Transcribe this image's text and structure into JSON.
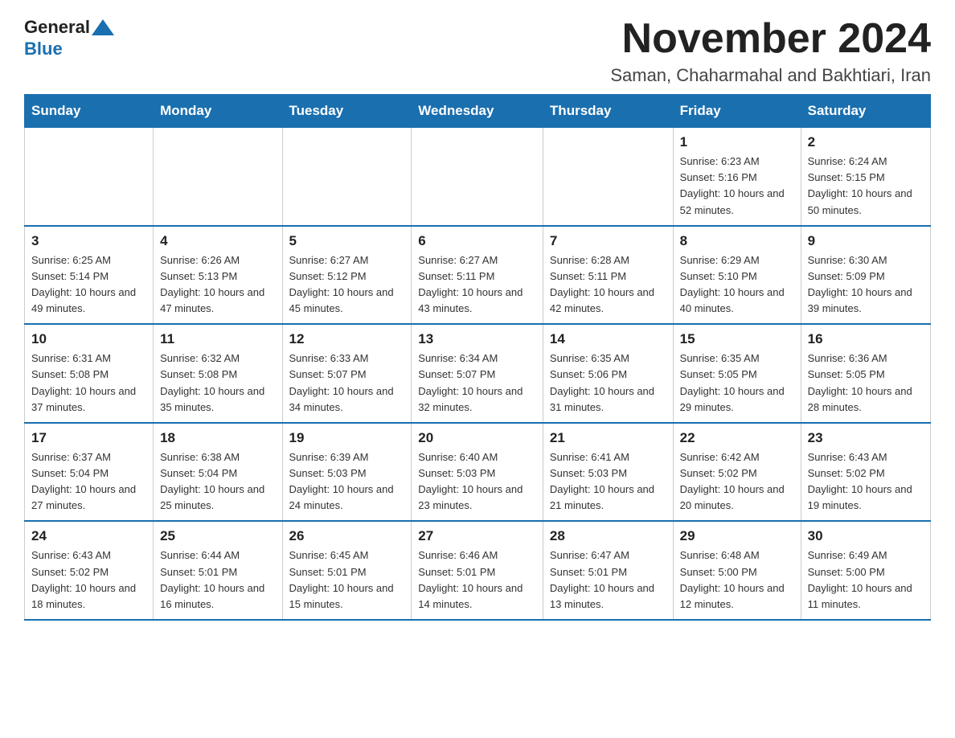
{
  "header": {
    "logo_general": "General",
    "logo_blue": "Blue",
    "month_year": "November 2024",
    "location": "Saman, Chaharmahal and Bakhtiari, Iran"
  },
  "weekdays": [
    "Sunday",
    "Monday",
    "Tuesday",
    "Wednesday",
    "Thursday",
    "Friday",
    "Saturday"
  ],
  "weeks": [
    [
      {
        "day": "",
        "info": ""
      },
      {
        "day": "",
        "info": ""
      },
      {
        "day": "",
        "info": ""
      },
      {
        "day": "",
        "info": ""
      },
      {
        "day": "",
        "info": ""
      },
      {
        "day": "1",
        "info": "Sunrise: 6:23 AM\nSunset: 5:16 PM\nDaylight: 10 hours and 52 minutes."
      },
      {
        "day": "2",
        "info": "Sunrise: 6:24 AM\nSunset: 5:15 PM\nDaylight: 10 hours and 50 minutes."
      }
    ],
    [
      {
        "day": "3",
        "info": "Sunrise: 6:25 AM\nSunset: 5:14 PM\nDaylight: 10 hours and 49 minutes."
      },
      {
        "day": "4",
        "info": "Sunrise: 6:26 AM\nSunset: 5:13 PM\nDaylight: 10 hours and 47 minutes."
      },
      {
        "day": "5",
        "info": "Sunrise: 6:27 AM\nSunset: 5:12 PM\nDaylight: 10 hours and 45 minutes."
      },
      {
        "day": "6",
        "info": "Sunrise: 6:27 AM\nSunset: 5:11 PM\nDaylight: 10 hours and 43 minutes."
      },
      {
        "day": "7",
        "info": "Sunrise: 6:28 AM\nSunset: 5:11 PM\nDaylight: 10 hours and 42 minutes."
      },
      {
        "day": "8",
        "info": "Sunrise: 6:29 AM\nSunset: 5:10 PM\nDaylight: 10 hours and 40 minutes."
      },
      {
        "day": "9",
        "info": "Sunrise: 6:30 AM\nSunset: 5:09 PM\nDaylight: 10 hours and 39 minutes."
      }
    ],
    [
      {
        "day": "10",
        "info": "Sunrise: 6:31 AM\nSunset: 5:08 PM\nDaylight: 10 hours and 37 minutes."
      },
      {
        "day": "11",
        "info": "Sunrise: 6:32 AM\nSunset: 5:08 PM\nDaylight: 10 hours and 35 minutes."
      },
      {
        "day": "12",
        "info": "Sunrise: 6:33 AM\nSunset: 5:07 PM\nDaylight: 10 hours and 34 minutes."
      },
      {
        "day": "13",
        "info": "Sunrise: 6:34 AM\nSunset: 5:07 PM\nDaylight: 10 hours and 32 minutes."
      },
      {
        "day": "14",
        "info": "Sunrise: 6:35 AM\nSunset: 5:06 PM\nDaylight: 10 hours and 31 minutes."
      },
      {
        "day": "15",
        "info": "Sunrise: 6:35 AM\nSunset: 5:05 PM\nDaylight: 10 hours and 29 minutes."
      },
      {
        "day": "16",
        "info": "Sunrise: 6:36 AM\nSunset: 5:05 PM\nDaylight: 10 hours and 28 minutes."
      }
    ],
    [
      {
        "day": "17",
        "info": "Sunrise: 6:37 AM\nSunset: 5:04 PM\nDaylight: 10 hours and 27 minutes."
      },
      {
        "day": "18",
        "info": "Sunrise: 6:38 AM\nSunset: 5:04 PM\nDaylight: 10 hours and 25 minutes."
      },
      {
        "day": "19",
        "info": "Sunrise: 6:39 AM\nSunset: 5:03 PM\nDaylight: 10 hours and 24 minutes."
      },
      {
        "day": "20",
        "info": "Sunrise: 6:40 AM\nSunset: 5:03 PM\nDaylight: 10 hours and 23 minutes."
      },
      {
        "day": "21",
        "info": "Sunrise: 6:41 AM\nSunset: 5:03 PM\nDaylight: 10 hours and 21 minutes."
      },
      {
        "day": "22",
        "info": "Sunrise: 6:42 AM\nSunset: 5:02 PM\nDaylight: 10 hours and 20 minutes."
      },
      {
        "day": "23",
        "info": "Sunrise: 6:43 AM\nSunset: 5:02 PM\nDaylight: 10 hours and 19 minutes."
      }
    ],
    [
      {
        "day": "24",
        "info": "Sunrise: 6:43 AM\nSunset: 5:02 PM\nDaylight: 10 hours and 18 minutes."
      },
      {
        "day": "25",
        "info": "Sunrise: 6:44 AM\nSunset: 5:01 PM\nDaylight: 10 hours and 16 minutes."
      },
      {
        "day": "26",
        "info": "Sunrise: 6:45 AM\nSunset: 5:01 PM\nDaylight: 10 hours and 15 minutes."
      },
      {
        "day": "27",
        "info": "Sunrise: 6:46 AM\nSunset: 5:01 PM\nDaylight: 10 hours and 14 minutes."
      },
      {
        "day": "28",
        "info": "Sunrise: 6:47 AM\nSunset: 5:01 PM\nDaylight: 10 hours and 13 minutes."
      },
      {
        "day": "29",
        "info": "Sunrise: 6:48 AM\nSunset: 5:00 PM\nDaylight: 10 hours and 12 minutes."
      },
      {
        "day": "30",
        "info": "Sunrise: 6:49 AM\nSunset: 5:00 PM\nDaylight: 10 hours and 11 minutes."
      }
    ]
  ]
}
